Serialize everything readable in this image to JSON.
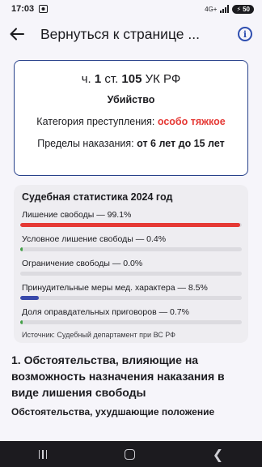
{
  "status_bar": {
    "time": "17:03",
    "network": "4G+",
    "battery": "50"
  },
  "header": {
    "back_icon": "arrow-left-icon",
    "title": "Вернуться к странице ...",
    "info_icon": "info-icon"
  },
  "article": {
    "prefix": "ч.",
    "part": "1",
    "mid": "ст.",
    "number": "105",
    "code": "УК РФ",
    "crime": "Убийство",
    "category_label": "Категория преступления:",
    "category_value": "особо тяжкое",
    "limits_label": "Пределы наказания:",
    "limits_value": "от 6 лет до 15 лет"
  },
  "stats": {
    "title": "Судебная статистика 2024 год",
    "rows": [
      {
        "label": "Лишение свободы — 99.1%",
        "percent": 99.1,
        "color": "#e53935"
      },
      {
        "label": "Условное лишение свободы — 0.4%",
        "percent": 0.4,
        "color": "#43a047"
      },
      {
        "label": "Ограничение свободы — 0.0%",
        "percent": 0.0,
        "color": "#43a047"
      },
      {
        "label": "Принудительные меры мед. характера — 8.5%",
        "percent": 8.5,
        "color": "#3949ab"
      },
      {
        "label": "Доля оправдательных приговоров — 0.7%",
        "percent": 0.7,
        "color": "#43a047"
      }
    ],
    "source": "Источник: Судебный департамент при ВС РФ"
  },
  "section": {
    "heading": "1. Обстоятельства, влияющие на возможность назначения наказания в виде лишения свободы",
    "subheading": "Обстоятельства, ухудшающие положение"
  }
}
